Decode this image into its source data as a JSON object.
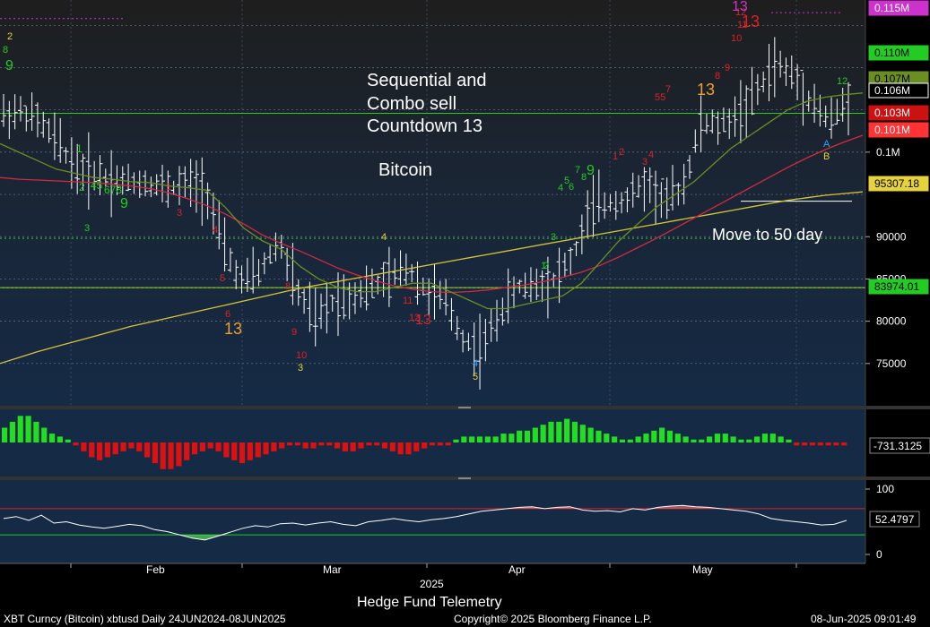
{
  "chart_data": [
    {
      "type": "line",
      "panel": "price",
      "annotations": {
        "headline": [
          "Sequential and",
          "Combo sell",
          "Countdown 13"
        ],
        "subject": "Bitcoin",
        "note": "Move to 50 day"
      },
      "y_ticks": [
        75000,
        80000,
        85000,
        90000,
        "0.1M"
      ],
      "y_tick_labels": [
        "75000",
        "80000",
        "85000",
        "90000",
        "0.1M"
      ],
      "price_tags": [
        {
          "text": "0.115M",
          "color": "#cc33cc"
        },
        {
          "text": "0.110M",
          "color": "#22cc22"
        },
        {
          "text": "0.107M",
          "color": "#6b8e23"
        },
        {
          "text": "0.106M",
          "color": "#ffffff"
        },
        {
          "text": "0.103M",
          "color": "#cc1111"
        },
        {
          "text": "0.101M",
          "color": "#ff3333"
        },
        {
          "text": "95307.18",
          "color": "#e6d23c"
        },
        {
          "text": "83974.01",
          "color": "#22cc22"
        }
      ],
      "series": [
        {
          "values_key": "close",
          "color": "#ffffff"
        },
        {
          "values_key": "ma_fast",
          "color": "#6b8e23"
        },
        {
          "values_key": "ma_50",
          "color": "#d22b3c"
        },
        {
          "values_key": "ma_200",
          "color": "#d4c438"
        }
      ],
      "x_dates": [
        "2025-01-20",
        "2025-01-23",
        "2025-01-26",
        "2025-01-29",
        "2025-02-01",
        "2025-02-04",
        "2025-02-07",
        "2025-02-10",
        "2025-02-13",
        "2025-02-16",
        "2025-02-19",
        "2025-02-22",
        "2025-02-25",
        "2025-02-28",
        "2025-03-03",
        "2025-03-06",
        "2025-03-09",
        "2025-03-12",
        "2025-03-15",
        "2025-03-18",
        "2025-03-21",
        "2025-03-24",
        "2025-03-27",
        "2025-03-30",
        "2025-04-02",
        "2025-04-05",
        "2025-04-08",
        "2025-04-11",
        "2025-04-14",
        "2025-04-17",
        "2025-04-20",
        "2025-04-23",
        "2025-04-26",
        "2025-04-29",
        "2025-05-02",
        "2025-05-05",
        "2025-05-08",
        "2025-05-11",
        "2025-05-14",
        "2025-05-17",
        "2025-05-20",
        "2025-05-23",
        "2025-05-26",
        "2025-05-29",
        "2025-06-01",
        "2025-06-04",
        "2025-06-07"
      ],
      "close": [
        104500,
        104800,
        103500,
        101000,
        98000,
        97500,
        96800,
        96500,
        96300,
        95700,
        96200,
        95900,
        88500,
        84500,
        86000,
        89500,
        83500,
        80000,
        82500,
        83000,
        84000,
        85000,
        86500,
        83500,
        82500,
        78000,
        76500,
        81000,
        84000,
        84500,
        85000,
        87500,
        93500,
        94000,
        94500,
        96500,
        94000,
        96000,
        103500,
        103000,
        104500,
        107000,
        110500,
        109000,
        106000,
        103500,
        106000
      ],
      "ma_fast": [
        101000,
        100000,
        99000,
        98000,
        97500,
        97000,
        96800,
        96500,
        96400,
        96000,
        95800,
        95500,
        93500,
        91000,
        89500,
        88500,
        86500,
        85000,
        84000,
        83500,
        83500,
        84000,
        84500,
        84500,
        83500,
        82500,
        81500,
        81500,
        82000,
        82500,
        83000,
        84500,
        87000,
        89500,
        91500,
        93500,
        95000,
        96500,
        98500,
        100500,
        102000,
        103500,
        105000,
        106000,
        106500,
        106800,
        107000
      ],
      "ma_50": [
        97000,
        96800,
        96700,
        96600,
        96500,
        96400,
        96200,
        96000,
        95700,
        95200,
        94500,
        93700,
        92700,
        91500,
        90200,
        89200,
        88300,
        87300,
        86300,
        85500,
        84800,
        84200,
        83800,
        83500,
        83400,
        83500,
        83700,
        84000,
        84300,
        84700,
        85200,
        85800,
        86600,
        87600,
        88700,
        89800,
        91000,
        92200,
        93400,
        94600,
        95800,
        97000,
        98200,
        99300,
        100300,
        101200,
        102000
      ],
      "ma_200": [
        75000,
        75700,
        76400,
        77000,
        77600,
        78200,
        78800,
        79400,
        79900,
        80400,
        80900,
        81400,
        81900,
        82400,
        82900,
        83400,
        83900,
        84300,
        84700,
        85100,
        85500,
        85900,
        86300,
        86700,
        87100,
        87500,
        87900,
        88300,
        88700,
        89100,
        89500,
        89900,
        90300,
        90700,
        91100,
        91500,
        91900,
        92300,
        92700,
        93100,
        93500,
        93900,
        94300,
        94600,
        94900,
        95100,
        95300
      ],
      "ylim": [
        70000,
        118000
      ]
    },
    {
      "type": "bar",
      "panel": "histogram",
      "y_tag": "-731.3125",
      "values": [
        5,
        7,
        9,
        9,
        7,
        5,
        3,
        2,
        1,
        -1,
        -3,
        -5,
        -6,
        -5,
        -4,
        -3,
        -2,
        -3,
        -5,
        -7,
        -9,
        -9,
        -8,
        -6,
        -4,
        -3,
        -2,
        -3,
        -5,
        -6,
        -7,
        -6,
        -5,
        -4,
        -3,
        -2,
        -1,
        -1,
        -2,
        -2,
        -1,
        -1,
        -2,
        -3,
        -3,
        -2,
        -1,
        -1,
        -2,
        -3,
        -4,
        -4,
        -3,
        -2,
        -1,
        -1,
        -1,
        1,
        2,
        2,
        2,
        2,
        2,
        3,
        3,
        4,
        4,
        5,
        6,
        7,
        7,
        8,
        7,
        6,
        5,
        4,
        3,
        2,
        1,
        1,
        2,
        3,
        4,
        5,
        4,
        3,
        2,
        1,
        1,
        2,
        3,
        3,
        2,
        1,
        1,
        2,
        3,
        3,
        2,
        1,
        -1,
        -1,
        -1,
        -1,
        -1,
        -1,
        -1
      ],
      "ylim": [
        -10,
        10
      ]
    },
    {
      "type": "line",
      "panel": "oscillator",
      "y_ticks": [
        0,
        100
      ],
      "y_tag": "52.4797",
      "upper_level": 70,
      "lower_level": 30,
      "values": [
        55,
        58,
        52,
        60,
        48,
        50,
        45,
        42,
        40,
        43,
        46,
        44,
        38,
        35,
        30,
        25,
        22,
        28,
        34,
        40,
        44,
        42,
        47,
        48,
        45,
        48,
        50,
        46,
        44,
        50,
        52,
        55,
        52,
        50,
        53,
        55,
        58,
        62,
        66,
        68,
        70,
        72,
        73,
        70,
        72,
        73,
        68,
        66,
        67,
        65,
        70,
        68,
        72,
        74,
        75,
        73,
        72,
        70,
        68,
        66,
        62,
        55,
        52,
        50,
        48,
        45,
        46,
        52
      ],
      "ylim": [
        0,
        108
      ]
    }
  ],
  "x_axis": {
    "months": [
      "Feb",
      "Mar",
      "Apr",
      "May"
    ],
    "year": "2025"
  },
  "footer": {
    "source": "Hedge Fund Telemetry",
    "ticker": "XBT Curncy (Bitcoin) xbtusd  Daily 24JUN2024-08JUN2025",
    "copyright": "Copyright© 2025 Bloomberg Finance L.P.",
    "timestamp": "08-Jun-2025 09:01:49"
  },
  "td_counts": [
    {
      "t": "2",
      "c": "#e6d23c"
    },
    {
      "t": "8",
      "c": "#22cc22"
    },
    {
      "t": "9",
      "c": "#22cc22"
    },
    {
      "t": "1",
      "c": "#22cc22"
    },
    {
      "t": "2",
      "c": "#22cc22"
    },
    {
      "t": "45",
      "c": "#22cc22"
    },
    {
      "t": "678",
      "c": "#22cc22"
    },
    {
      "t": "9",
      "c": "#22cc22"
    },
    {
      "t": "3",
      "c": "#22cc22"
    },
    {
      "t": "1",
      "c": "#dd2222"
    },
    {
      "t": "3",
      "c": "#dd2222"
    },
    {
      "t": "4",
      "c": "#dd2222"
    },
    {
      "t": "5",
      "c": "#dd2222"
    },
    {
      "t": "6",
      "c": "#dd2222"
    },
    {
      "t": "13",
      "c": "#f0a030"
    },
    {
      "t": "8",
      "c": "#dd2222"
    },
    {
      "t": "9",
      "c": "#dd2222"
    },
    {
      "t": "10",
      "c": "#dd2222"
    },
    {
      "t": "3",
      "c": "#e6d23c"
    },
    {
      "t": "4",
      "c": "#e6d23c"
    },
    {
      "t": "11",
      "c": "#dd2222"
    },
    {
      "t": "12",
      "c": "#dd2222"
    },
    {
      "t": "13",
      "c": "#dd2222"
    },
    {
      "t": "4",
      "c": "#22aaff"
    },
    {
      "t": "5",
      "c": "#e6d23c"
    },
    {
      "t": "1",
      "c": "#22cc22"
    },
    {
      "t": "2",
      "c": "#22cc22"
    },
    {
      "t": "3",
      "c": "#22cc22"
    },
    {
      "t": "4",
      "c": "#22cc22"
    },
    {
      "t": "5",
      "c": "#22cc22"
    },
    {
      "t": "6",
      "c": "#22cc22"
    },
    {
      "t": "7",
      "c": "#22cc22"
    },
    {
      "t": "8",
      "c": "#22cc22"
    },
    {
      "t": "9",
      "c": "#22cc22"
    },
    {
      "t": "1",
      "c": "#dd2222"
    },
    {
      "t": "2",
      "c": "#dd2222"
    },
    {
      "t": "3",
      "c": "#dd2222"
    },
    {
      "t": "4",
      "c": "#dd2222"
    },
    {
      "t": "55",
      "c": "#dd2222"
    },
    {
      "t": "7",
      "c": "#dd2222"
    },
    {
      "t": "13",
      "c": "#f0a030"
    },
    {
      "t": "8",
      "c": "#dd2222"
    },
    {
      "t": "9",
      "c": "#dd2222"
    },
    {
      "t": "10",
      "c": "#dd2222"
    },
    {
      "t": "11",
      "c": "#dd2222"
    },
    {
      "t": "12",
      "c": "#dd2222"
    },
    {
      "t": "13",
      "c": "#dd2222"
    },
    {
      "t": "13",
      "c": "#cc33cc"
    },
    {
      "t": "12",
      "c": "#22cc22"
    },
    {
      "t": "A",
      "c": "#22aaff"
    },
    {
      "t": "B",
      "c": "#e6d23c"
    }
  ]
}
